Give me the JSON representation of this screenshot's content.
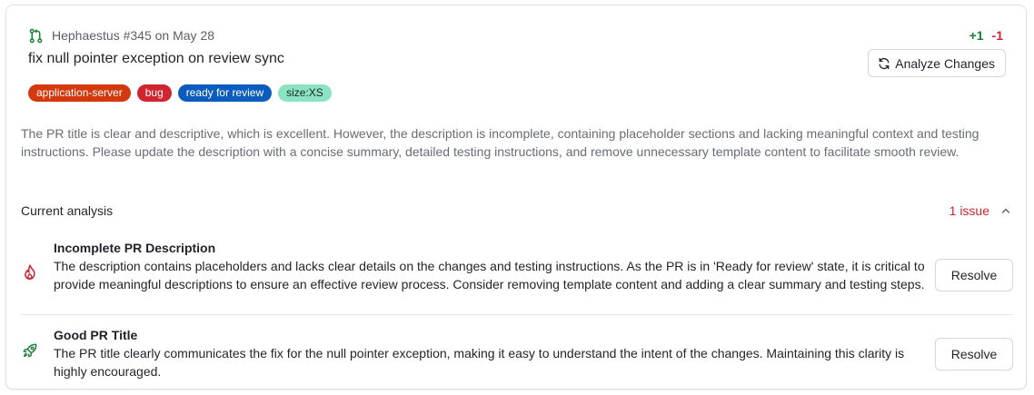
{
  "header": {
    "pr_meta": "Hephaestus #345 on May 28",
    "pr_title": "fix null pointer exception on review sync",
    "additions": "+1",
    "deletions": "-1",
    "analyze_label": "Analyze Changes"
  },
  "labels": [
    {
      "text": "application-server",
      "color": "#d4380d",
      "text_color": "#ffffff"
    },
    {
      "text": "bug",
      "color": "#d1242f",
      "text_color": "#ffffff"
    },
    {
      "text": "ready for review",
      "color": "#0b5cbd",
      "text_color": "#ffffff"
    },
    {
      "text": "size:XS",
      "color": "#8ae3c1",
      "text_color": "#1f2328"
    }
  ],
  "summary": "The PR title is clear and descriptive, which is excellent. However, the description is incomplete, containing placeholder sections and lacking meaningful context and testing instructions. Please update the description with a concise summary, detailed testing instructions, and remove unnecessary template content to facilitate smooth review.",
  "analysis": {
    "heading": "Current analysis",
    "issue_count": "1 issue"
  },
  "items": [
    {
      "icon": "flame-icon",
      "title": "Incomplete PR Description",
      "body": "The description contains placeholders and lacks clear details on the changes and testing instructions. As the PR is in 'Ready for review' state, it is critical to provide meaningful descriptions to ensure an effective review process. Consider removing template content and adding a clear summary and testing steps.",
      "button": "Resolve",
      "icon_color": "#cf222e"
    },
    {
      "icon": "rocket-icon",
      "title": "Good PR Title",
      "body": "The PR title clearly communicates the fix for the null pointer exception, making it easy to understand the intent of the changes. Maintaining this clarity is highly encouraged.",
      "button": "Resolve",
      "icon_color": "#1a7f37"
    }
  ],
  "colors": {
    "accent_green": "#1a7f37",
    "accent_red": "#cf222e"
  }
}
